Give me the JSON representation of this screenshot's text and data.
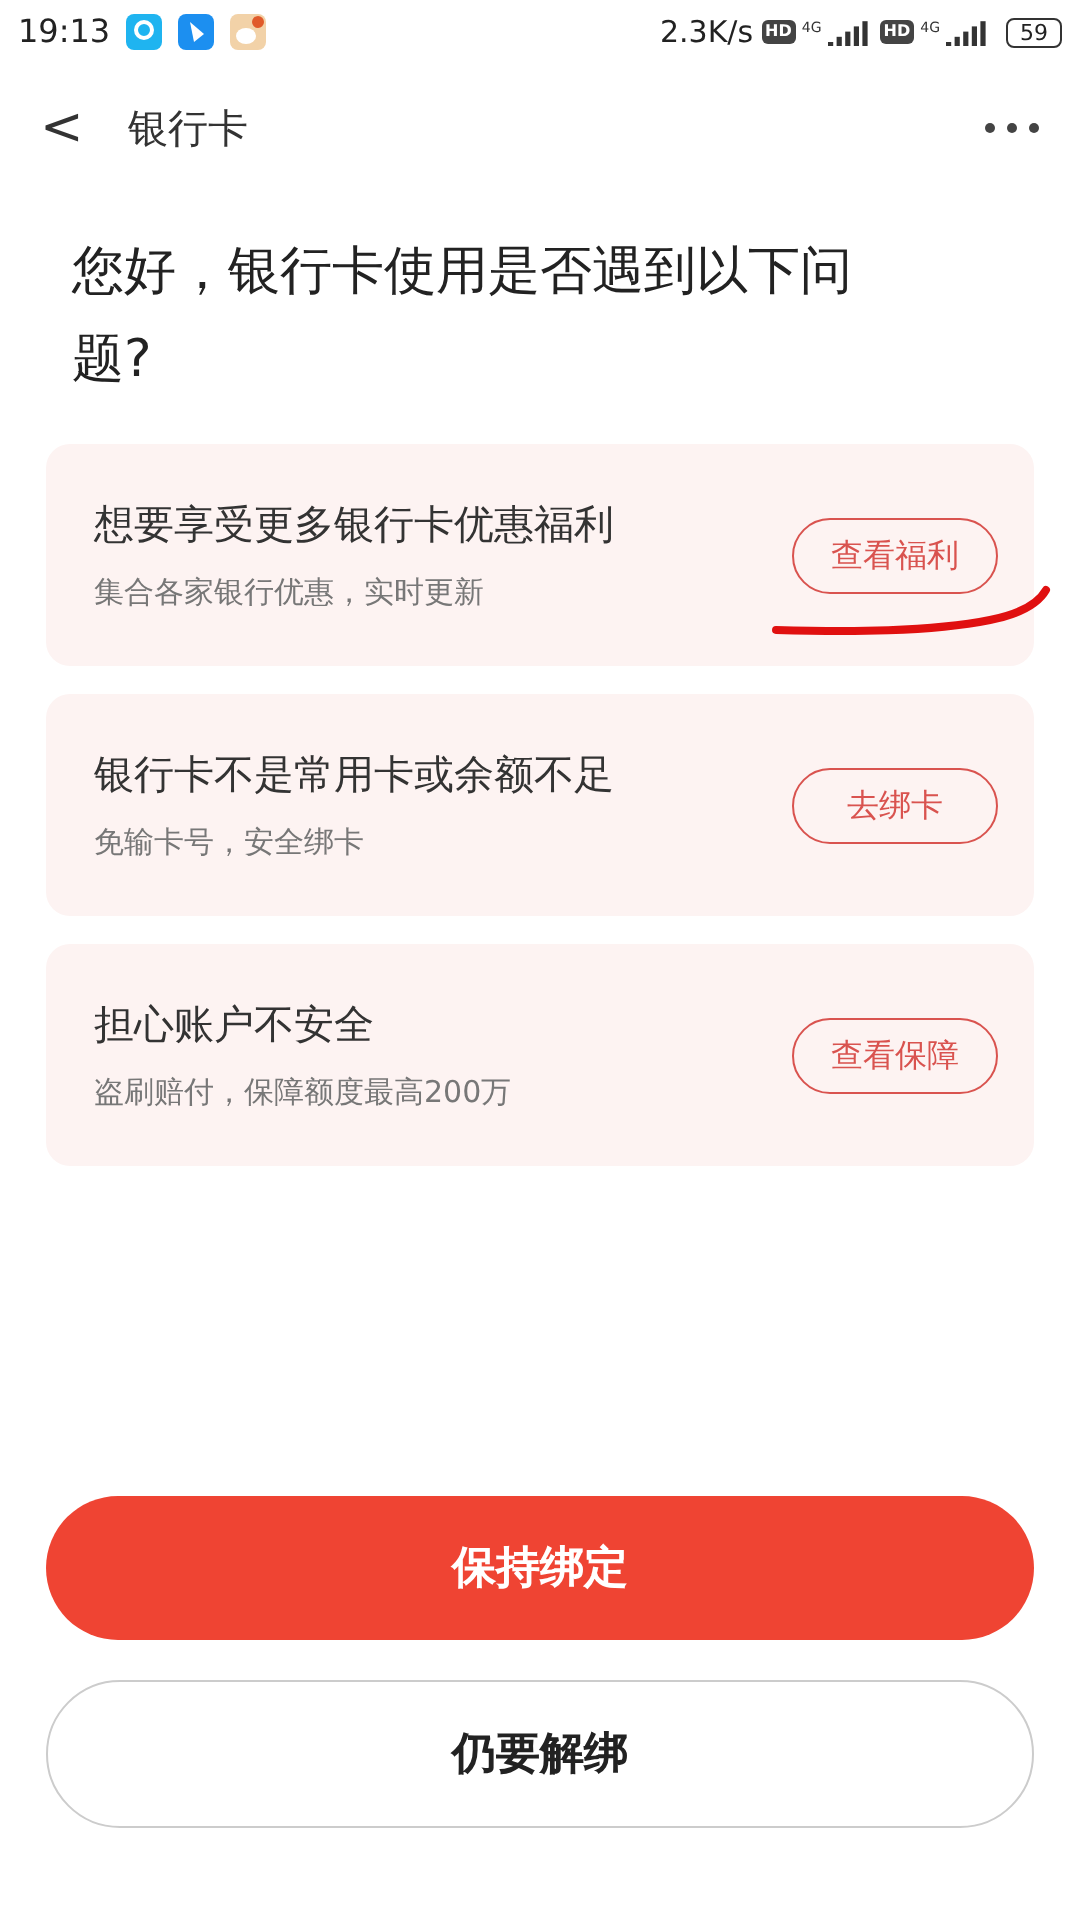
{
  "status_bar": {
    "time": "19:13",
    "speed": "2.3K/s",
    "hd_badges": [
      "HD",
      "HD"
    ],
    "network_labels": [
      "4G",
      "4G"
    ],
    "battery": "59"
  },
  "header": {
    "back": "<",
    "title": "银行卡"
  },
  "question": "您好，银行卡使用是否遇到以下问题?",
  "cards": [
    {
      "title": "想要享受更多银行卡优惠福利",
      "subtitle": "集合各家银行优惠，实时更新",
      "action": "查看福利",
      "underlined": true
    },
    {
      "title": "银行卡不是常用卡或余额不足",
      "subtitle": "免输卡号，安全绑卡",
      "action": "去绑卡",
      "underlined": false
    },
    {
      "title": "担心账户不安全",
      "subtitle": "盗刷赔付，保障额度最高200万",
      "action": "查看保障",
      "underlined": false
    }
  ],
  "buttons": [
    {
      "label": "保持绑定",
      "kind": "primary"
    },
    {
      "label": "仍要解绑",
      "kind": "outline"
    }
  ]
}
